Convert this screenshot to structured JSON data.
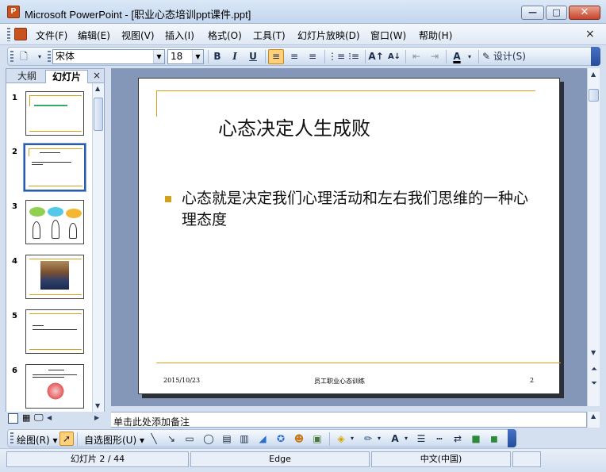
{
  "window": {
    "title": "Microsoft PowerPoint - [职业心态培训ppt课件.ppt]",
    "icon": "powerpoint-icon",
    "minimize_glyph": "—",
    "maximize_glyph": "□",
    "close_glyph": "✕"
  },
  "menu": {
    "items": [
      {
        "label": "文件(F)"
      },
      {
        "label": "编辑(E)"
      },
      {
        "label": "视图(V)"
      },
      {
        "label": "插入(I)"
      },
      {
        "label": "格式(O)"
      },
      {
        "label": "工具(T)"
      },
      {
        "label": "幻灯片放映(D)"
      },
      {
        "label": "窗口(W)"
      },
      {
        "label": "帮助(H)"
      }
    ],
    "close_glyph": "×"
  },
  "format_toolbar": {
    "font_name": "宋体",
    "font_size": "18",
    "bold": "B",
    "italic": "I",
    "underline": "U",
    "design_label": "设计(S)"
  },
  "left_pane": {
    "tab_outline": "大纲",
    "tab_slides": "幻灯片",
    "close_glyph": "×",
    "thumbnails": [
      {
        "number": "1"
      },
      {
        "number": "2",
        "selected": true
      },
      {
        "number": "3"
      },
      {
        "number": "4"
      },
      {
        "number": "5"
      },
      {
        "number": "6"
      }
    ]
  },
  "slide": {
    "title": "心态决定人生成败",
    "bullet": "心态就是决定我们心理活动和左右我们思维的一种心理态度",
    "date": "2015/10/23",
    "footer": "员工职业心态训练",
    "page": "2",
    "accent_color": "#d4a017"
  },
  "notes": {
    "placeholder": "单击此处添加备注"
  },
  "draw_toolbar": {
    "draw_label": "绘图(R)",
    "autoshapes_label": "自选图形(U)"
  },
  "status": {
    "slide_counter": "幻灯片 2 / 44",
    "design": "Edge",
    "language": "中文(中国)"
  }
}
